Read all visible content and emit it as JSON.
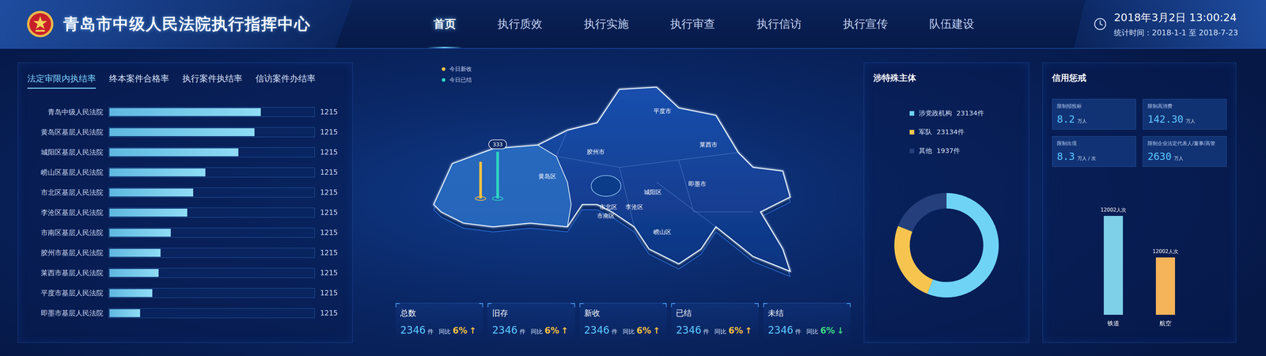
{
  "header": {
    "title": "青岛市中级人民法院执行指挥中心",
    "datetime": "2018年3月2日 13:00:24",
    "period": "统计时间：2018-1-1 至 2018-7-23"
  },
  "nav": [
    {
      "label": "首页",
      "selected": true
    },
    {
      "label": "执行质效",
      "selected": false
    },
    {
      "label": "执行实施",
      "selected": false
    },
    {
      "label": "执行审查",
      "selected": false
    },
    {
      "label": "执行信访",
      "selected": false
    },
    {
      "label": "执行宣传",
      "selected": false
    },
    {
      "label": "队伍建设",
      "selected": false
    }
  ],
  "ranking": {
    "tabs": [
      {
        "label": "法定审限内执结率",
        "selected": true
      },
      {
        "label": "终本案件合格率",
        "selected": false
      },
      {
        "label": "执行案件执结率",
        "selected": false
      },
      {
        "label": "信访案件办结率",
        "selected": false
      }
    ],
    "rows": [
      {
        "name": "青岛中级人民法院",
        "value": "1215",
        "level": 0.74
      },
      {
        "name": "黄岛区基层人民法院",
        "value": "1215",
        "level": 0.71
      },
      {
        "name": "城阳区基层人民法院",
        "value": "1215",
        "level": 0.63
      },
      {
        "name": "崂山区基层人民法院",
        "value": "1215",
        "level": 0.47
      },
      {
        "name": "市北区基层人民法院",
        "value": "1215",
        "level": 0.41
      },
      {
        "name": "李沧区基层人民法院",
        "value": "1215",
        "level": 0.38
      },
      {
        "name": "市南区基层人民法院",
        "value": "1215",
        "level": 0.3
      },
      {
        "name": "胶州市基层人民法院",
        "value": "1215",
        "level": 0.25
      },
      {
        "name": "莱西市基层人民法院",
        "value": "1215",
        "level": 0.24
      },
      {
        "name": "平度市基层人民法院",
        "value": "1215",
        "level": 0.21
      },
      {
        "name": "即墨市基层人民法院",
        "value": "1215",
        "level": 0.15
      }
    ]
  },
  "map": {
    "legend": [
      {
        "label": "今日新收",
        "color": "#f5c242"
      },
      {
        "label": "今日已结",
        "color": "#2fd6c4"
      }
    ],
    "districts": [
      "平度市",
      "胶州市",
      "莱西市",
      "黄岛区",
      "城阳区",
      "即墨市",
      "市北区",
      "李沧区",
      "市南区",
      "崂山区"
    ],
    "pins": [
      {
        "label": null,
        "level": 0.55,
        "color": "#f5c242"
      },
      {
        "label": "333",
        "level": 0.7,
        "color": "#2fd6c4"
      }
    ]
  },
  "stats": [
    {
      "label": "总数",
      "value": "2346",
      "unit": "件",
      "compare": "同比",
      "change": "6%",
      "arrow": "↑",
      "color": "#f5c242"
    },
    {
      "label": "旧存",
      "value": "2346",
      "unit": "件",
      "compare": "同比",
      "change": "6%",
      "arrow": "↑",
      "color": "#f5c242"
    },
    {
      "label": "新收",
      "value": "2346",
      "unit": "件",
      "compare": "同比",
      "change": "6%",
      "arrow": "↑",
      "color": "#f5c242"
    },
    {
      "label": "已结",
      "value": "2346",
      "unit": "件",
      "compare": "同比",
      "change": "6%",
      "arrow": "↑",
      "color": "#f5c242"
    },
    {
      "label": "未结",
      "value": "2346",
      "unit": "件",
      "compare": "同比",
      "change": "6%",
      "arrow": "↓",
      "color": "#3ddc84"
    }
  ],
  "special": {
    "title": "涉特殊主体",
    "legend": [
      {
        "label": "涉党政机构",
        "count": "23134件",
        "color": "#6fd3f5"
      },
      {
        "label": "军队",
        "count": "23134件",
        "color": "#f7c54f"
      },
      {
        "label": "其他",
        "count": "1937件",
        "color": "#243f7c"
      }
    ],
    "donut": [
      56,
      25,
      19
    ]
  },
  "credit": {
    "title": "信用惩戒",
    "cards": [
      {
        "label": "限制招投标",
        "value": "8.2",
        "unit": "万人"
      },
      {
        "label": "限制高消费",
        "value": "142.30",
        "unit": "万人"
      },
      {
        "label": "限制出境",
        "value": "8.3",
        "unit": "万人 / 次"
      },
      {
        "label": "限制企业法定代表人/董事/高管",
        "value": "2630",
        "unit": "万人"
      }
    ],
    "bars": [
      {
        "label": "铁道",
        "value": "12002人次",
        "level": 1.0,
        "color": "#7ecfe8"
      },
      {
        "label": "航空",
        "value": "12002人次",
        "level": 0.58,
        "color": "#f5b45a"
      }
    ]
  }
}
